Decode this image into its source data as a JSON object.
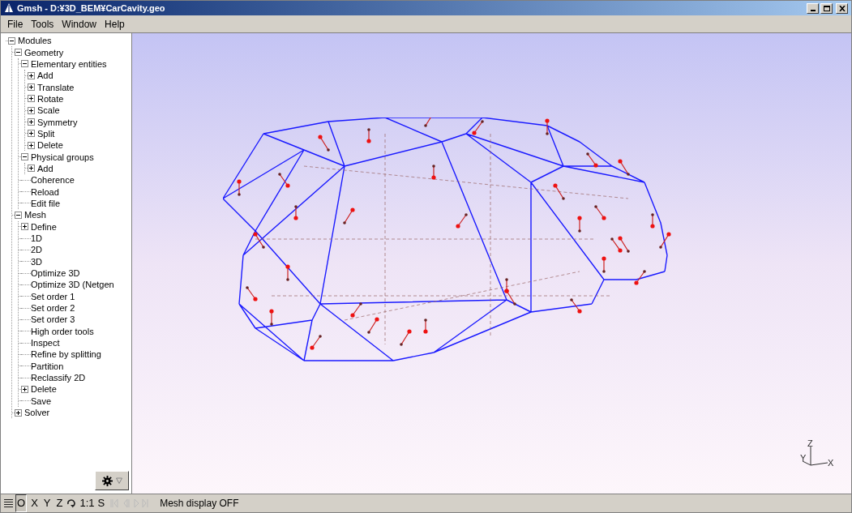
{
  "window": {
    "title": "Gmsh - D:¥3D_BEM¥CarCavity.geo"
  },
  "menu": [
    "File",
    "Tools",
    "Window",
    "Help"
  ],
  "tree": [
    {
      "label": "Modules",
      "expanded": true,
      "children": [
        {
          "label": "Geometry",
          "expanded": true,
          "children": [
            {
              "label": "Elementary entities",
              "expanded": true,
              "children": [
                {
                  "label": "Add",
                  "expanded": false
                },
                {
                  "label": "Translate",
                  "expanded": false
                },
                {
                  "label": "Rotate",
                  "expanded": false
                },
                {
                  "label": "Scale",
                  "expanded": false
                },
                {
                  "label": "Symmetry",
                  "expanded": false
                },
                {
                  "label": "Split",
                  "expanded": false
                },
                {
                  "label": "Delete",
                  "expanded": false
                }
              ]
            },
            {
              "label": "Physical groups",
              "expanded": true,
              "children": [
                {
                  "label": "Add",
                  "expanded": false
                }
              ]
            },
            {
              "label": "Coherence"
            },
            {
              "label": "Reload"
            },
            {
              "label": "Edit file"
            }
          ]
        },
        {
          "label": "Mesh",
          "expanded": true,
          "children": [
            {
              "label": "Define",
              "expanded": false
            },
            {
              "label": "1D"
            },
            {
              "label": "2D"
            },
            {
              "label": "3D"
            },
            {
              "label": "Optimize 3D"
            },
            {
              "label": "Optimize 3D (Netgen"
            },
            {
              "label": "Set order 1"
            },
            {
              "label": "Set order 2"
            },
            {
              "label": "Set order 3"
            },
            {
              "label": "High order tools"
            },
            {
              "label": "Inspect"
            },
            {
              "label": "Refine by splitting"
            },
            {
              "label": "Partition"
            },
            {
              "label": "Reclassify 2D"
            },
            {
              "label": "Delete",
              "expanded": false
            },
            {
              "label": "Save"
            }
          ]
        },
        {
          "label": "Solver",
          "expanded": false
        }
      ]
    }
  ],
  "axes": {
    "z": "Z",
    "y": "Y",
    "x": "X"
  },
  "status_bar": {
    "buttons": [
      {
        "label": "O",
        "selected": true
      },
      {
        "label": "X",
        "selected": false
      },
      {
        "label": "Y",
        "selected": false
      },
      {
        "label": "Z",
        "selected": false
      }
    ],
    "scale": "1:1",
    "s": "S",
    "message": "Mesh display OFF"
  }
}
